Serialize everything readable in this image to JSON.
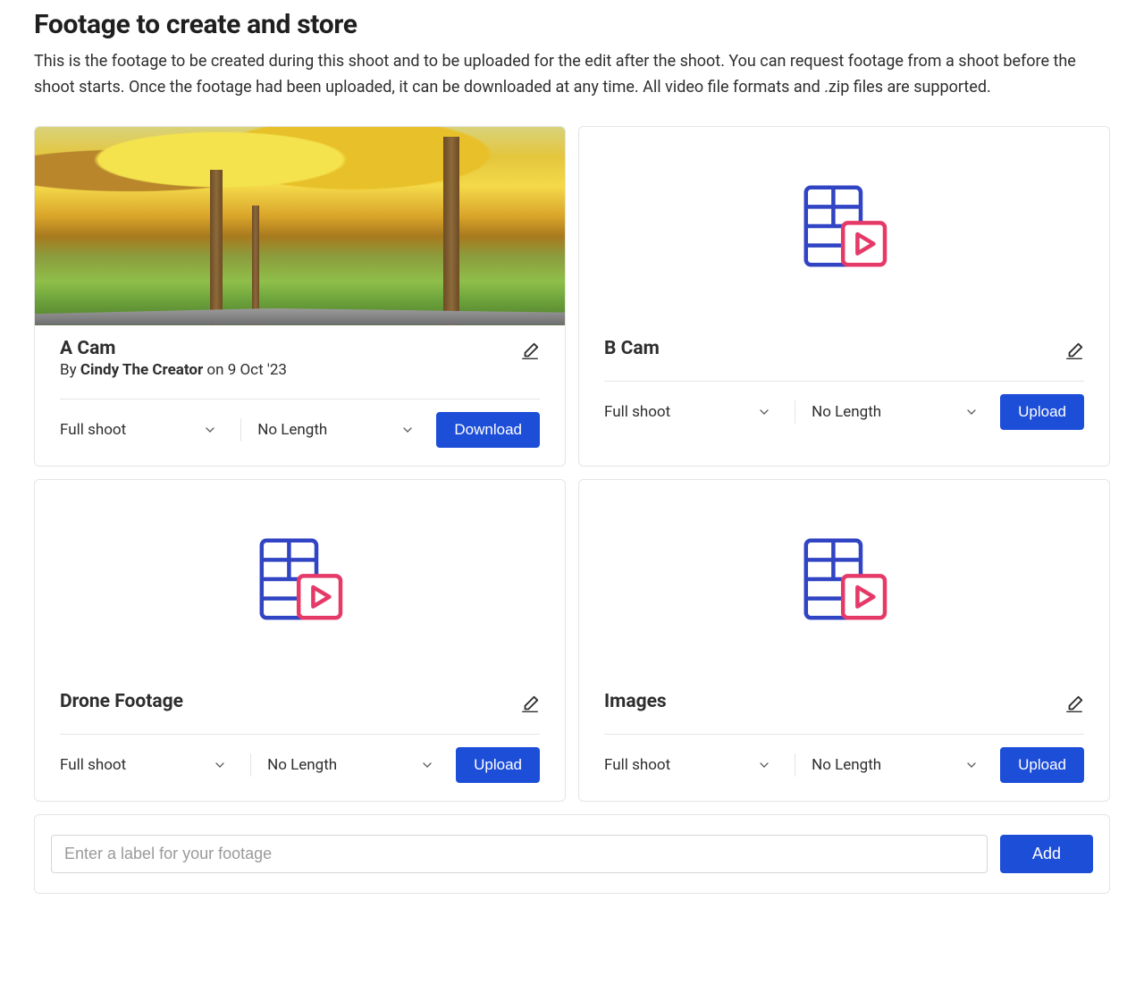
{
  "header": {
    "title": "Footage to create and store",
    "description": "This is the footage to be created during this shoot and to be uploaded for the edit after the shoot. You can request footage from a shoot before the shoot starts. Once the footage had been uploaded, it can be downloaded at any time. All video file formats and .zip files are supported."
  },
  "cards": {
    "a_cam": {
      "title": "A Cam",
      "by_prefix": "By ",
      "author": "Cindy The Creator",
      "by_suffix": " on 9 Oct '23",
      "select_type": "Full shoot",
      "select_length": "No Length",
      "action": "Download"
    },
    "b_cam": {
      "title": "B Cam",
      "select_type": "Full shoot",
      "select_length": "No Length",
      "action": "Upload"
    },
    "drone": {
      "title": "Drone Footage",
      "select_type": "Full shoot",
      "select_length": "No Length",
      "action": "Upload"
    },
    "images": {
      "title": "Images",
      "select_type": "Full shoot",
      "select_length": "No Length",
      "action": "Upload"
    }
  },
  "add_row": {
    "placeholder": "Enter a label for your footage",
    "button": "Add"
  }
}
